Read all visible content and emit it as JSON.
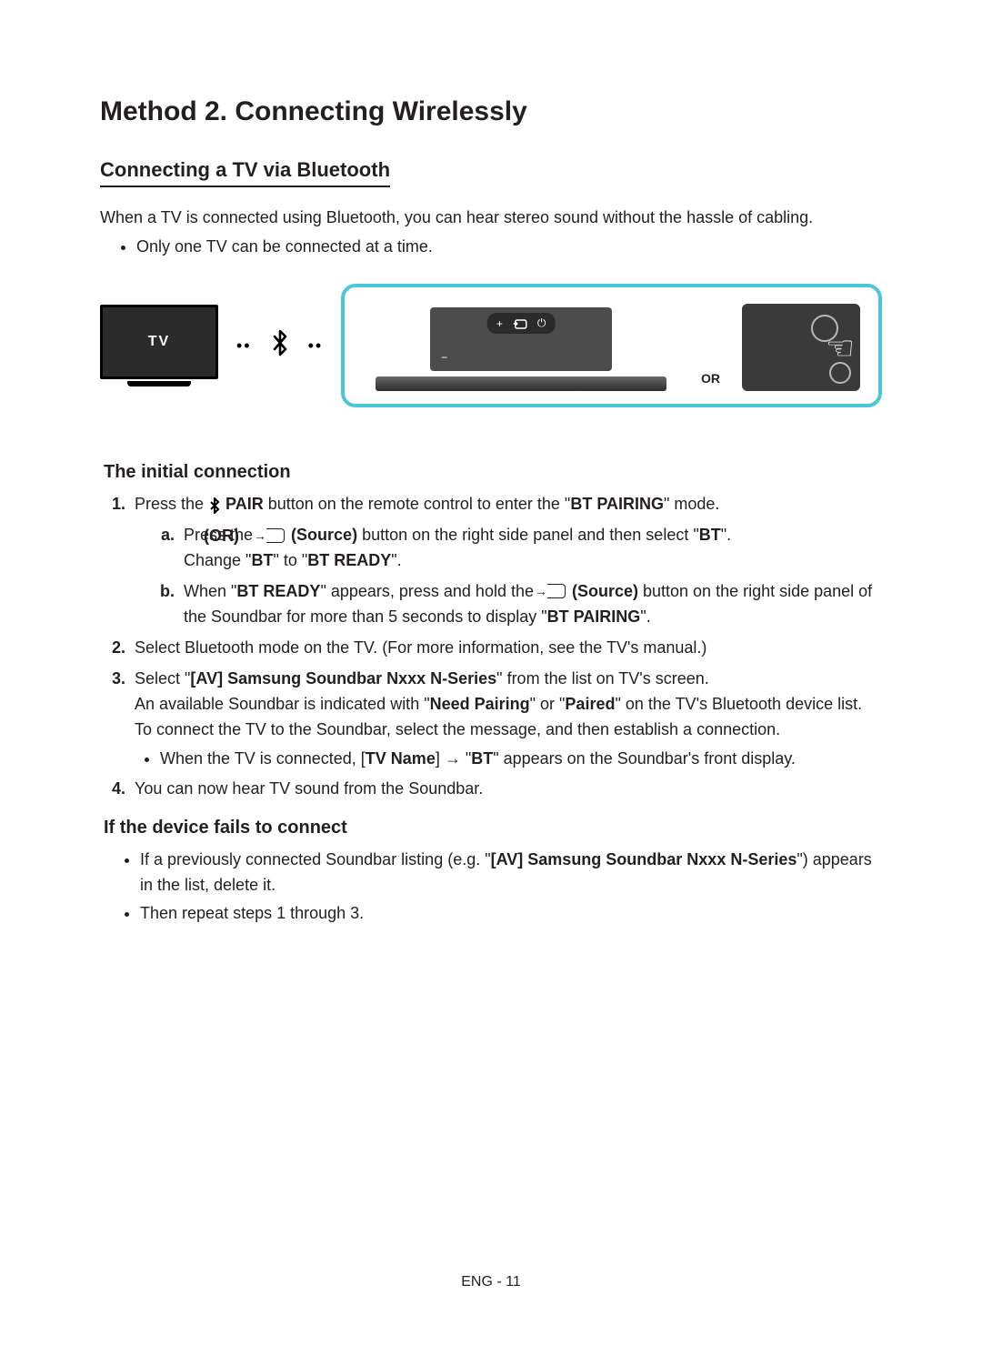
{
  "title": "Method 2. Connecting Wirelessly",
  "section1": {
    "heading": "Connecting a TV via Bluetooth",
    "intro": "When a TV is connected using Bluetooth, you can hear stereo sound without the hassle of cabling.",
    "bullet1": "Only one TV can be connected at a time."
  },
  "figure": {
    "tv_label": "TV",
    "or_label": "OR"
  },
  "initial": {
    "heading": "The initial connection",
    "or_aside": "(OR)",
    "step1_pre": "Press the ",
    "step1_pair": " PAIR",
    "step1_mid": " button on the remote control to enter the \"",
    "step1_btpairing": "BT PAIRING",
    "step1_post": "\" mode.",
    "step1a_pre": "Press the ",
    "step1a_source": " (Source)",
    "step1a_mid": " button on the right side panel and then select \"",
    "step1a_bt": "BT",
    "step1a_post": "\".",
    "step1a_line2_pre": "Change \"",
    "step1a_line2_bt": "BT",
    "step1a_line2_mid": "\" to \"",
    "step1a_line2_btready": "BT READY",
    "step1a_line2_post": "\".",
    "step1b_pre": "When \"",
    "step1b_btready": "BT READY",
    "step1b_mid1": "\" appears, press and hold the ",
    "step1b_source": " (Source)",
    "step1b_mid2": " button on the right side panel of the Soundbar for more than 5 seconds to display \"",
    "step1b_btpairing": "BT PAIRING",
    "step1b_post": "\".",
    "step2": "Select Bluetooth mode on the TV. (For more information, see the TV's manual.)",
    "step3_pre": "Select \"",
    "step3_device": "[AV] Samsung Soundbar Nxxx N-Series",
    "step3_mid1": "\" from the list on TV's screen.",
    "step3_line2_pre": "An available Soundbar is indicated with \"",
    "step3_needpairing": "Need Pairing",
    "step3_line2_mid": "\" or \"",
    "step3_paired": "Paired",
    "step3_line2_post": "\" on the TV's Bluetooth device list. To connect the TV to the Soundbar, select the message, and then establish a connection.",
    "step3_sub_pre": "When the TV is connected, [",
    "step3_sub_tvname": "TV Name",
    "step3_sub_mid": "] → \"",
    "step3_sub_bt": "BT",
    "step3_sub_post": "\" appears on the Soundbar's front display.",
    "step4": "You can now hear TV sound from the Soundbar."
  },
  "fails": {
    "heading": "If the device fails to connect",
    "b1_pre": "If a previously connected Soundbar listing (e.g. \"",
    "b1_device": "[AV] Samsung Soundbar Nxxx N-Series",
    "b1_post": "\") appears in the list, delete it.",
    "b2": "Then repeat steps 1 through 3."
  },
  "footer": "ENG - 11",
  "nums": {
    "n1": "1.",
    "n2": "2.",
    "n3": "3.",
    "n4": "4.",
    "a": "a.",
    "b": "b."
  }
}
